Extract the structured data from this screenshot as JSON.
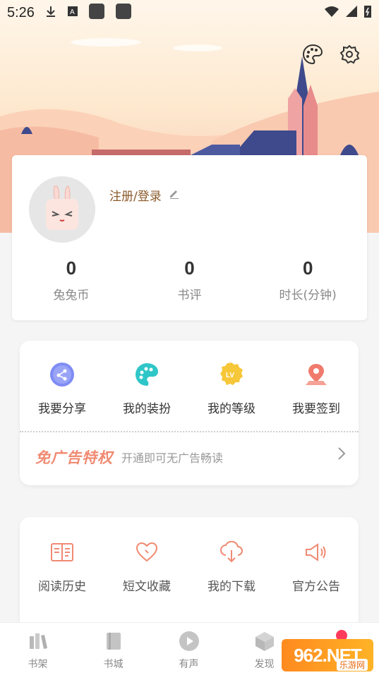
{
  "status_bar": {
    "time": "5:26"
  },
  "profile": {
    "login_label": "注册/登录",
    "stats": [
      {
        "value": "0",
        "label": "兔兔币"
      },
      {
        "value": "0",
        "label": "书评"
      },
      {
        "value": "0",
        "label": "时长(分钟)"
      }
    ]
  },
  "features": [
    {
      "label": "我要分享",
      "icon": "share-icon",
      "color": "#7f8cf5"
    },
    {
      "label": "我的装扮",
      "icon": "palette-icon",
      "color": "#2fc6c8"
    },
    {
      "label": "我的等级",
      "icon": "level-badge-icon",
      "color": "#f7c73a"
    },
    {
      "label": "我要签到",
      "icon": "location-checkin-icon",
      "color": "#f07b6d"
    }
  ],
  "ad_banner": {
    "title": "免广告特权",
    "subtitle": "开通即可无广告畅读"
  },
  "tools": [
    {
      "label": "阅读历史",
      "icon": "book-history-icon"
    },
    {
      "label": "短文收藏",
      "icon": "heart-icon"
    },
    {
      "label": "我的下载",
      "icon": "cloud-download-icon"
    },
    {
      "label": "官方公告",
      "icon": "megaphone-icon"
    }
  ],
  "bottom_nav": [
    {
      "label": "书架",
      "icon": "bookshelf-icon"
    },
    {
      "label": "书城",
      "icon": "book-icon"
    },
    {
      "label": "有声",
      "icon": "play-icon"
    },
    {
      "label": "发现",
      "icon": "cube-icon"
    }
  ],
  "watermark": {
    "text": "962.NET",
    "badge": "乐游网"
  },
  "colors": {
    "accent": "#f08a72",
    "login": "#8a5a2b",
    "tool_icon": "#f08a72"
  }
}
